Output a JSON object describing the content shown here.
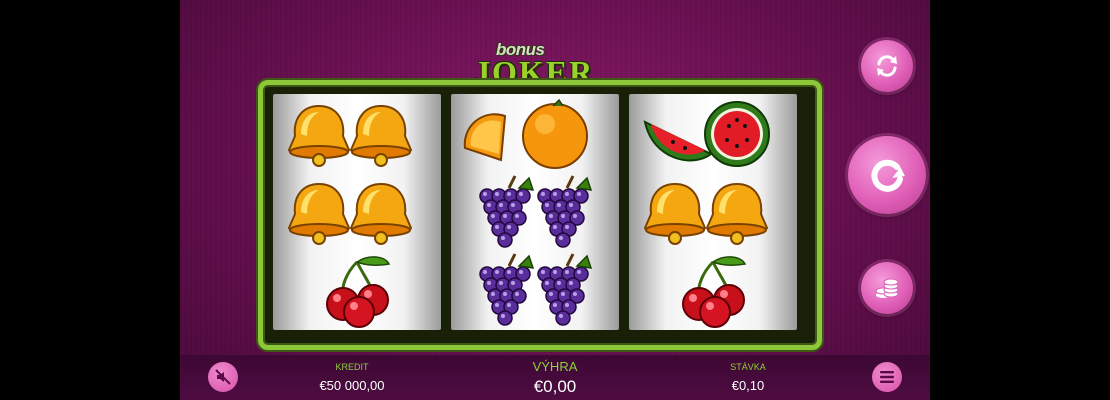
{
  "logo": {
    "small_text": "bonus",
    "big_text": "JOKER"
  },
  "reels": [
    [
      "bell",
      "bell",
      "cherry"
    ],
    [
      "orange",
      "grapes",
      "grapes"
    ],
    [
      "watermelon",
      "bell",
      "cherry"
    ]
  ],
  "buttons": {
    "autoplay_icon": "autoplay-arrows-icon",
    "spin_icon": "spin-arrow-icon",
    "bet_icon": "coins-icon",
    "sound_icon": "sound-muted-icon",
    "menu_icon": "hamburger-menu-icon"
  },
  "bottom_bar": {
    "credit_label": "KREDIT",
    "credit_value": "€50 000,00",
    "win_label": "VÝHRA",
    "win_value": "€0,00",
    "bet_label": "STÁVKA",
    "bet_value": "€0,10"
  },
  "colors": {
    "background": "#6e1255",
    "frame": "#8cc83a",
    "label_green": "#8cd03e",
    "button_pink": "#e060b8"
  }
}
